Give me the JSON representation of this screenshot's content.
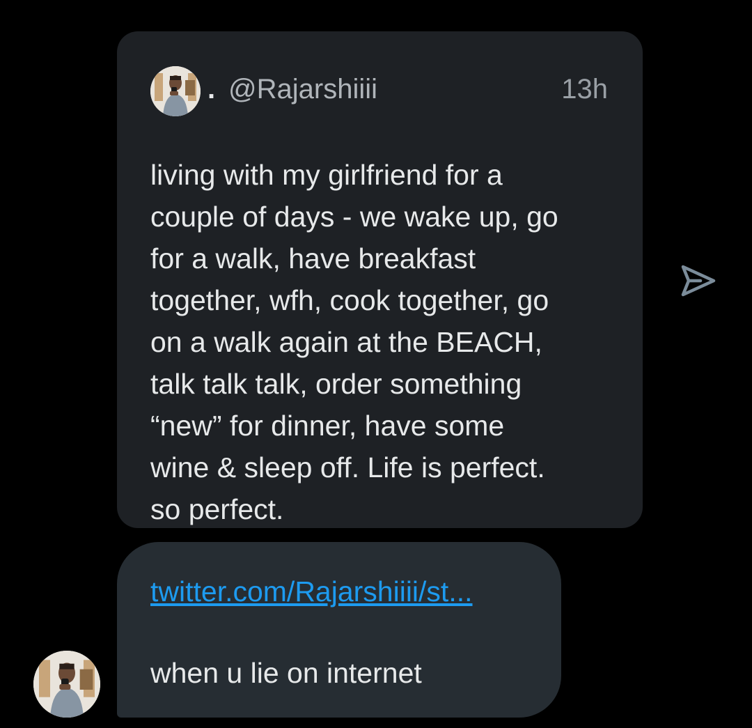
{
  "quoted_tweet": {
    "separator": ".",
    "handle": "@Rajarshiiii",
    "time": "13h",
    "text": "living with my girlfriend for a\ncouple of days - we wake up, go\nfor a walk, have breakfast\ntogether, wfh, cook together, go\non a walk again at the BEACH,\ntalk talk talk, order something\n“new” for dinner, have some\nwine & sleep off. Life is perfect.\nso perfect.",
    "avatar_icon": "profile-photo"
  },
  "share": {
    "icon": "send-icon"
  },
  "message": {
    "link": "twitter.com/Rajarshiiii/st...",
    "text": "when u lie on internet"
  },
  "sender": {
    "avatar_icon": "profile-photo"
  },
  "colors": {
    "background": "#000000",
    "card": "#1e2125",
    "bubble": "#262d33",
    "link": "#1d9bf0",
    "text": "#e7e9ea",
    "muted": "#9aa0a6"
  }
}
